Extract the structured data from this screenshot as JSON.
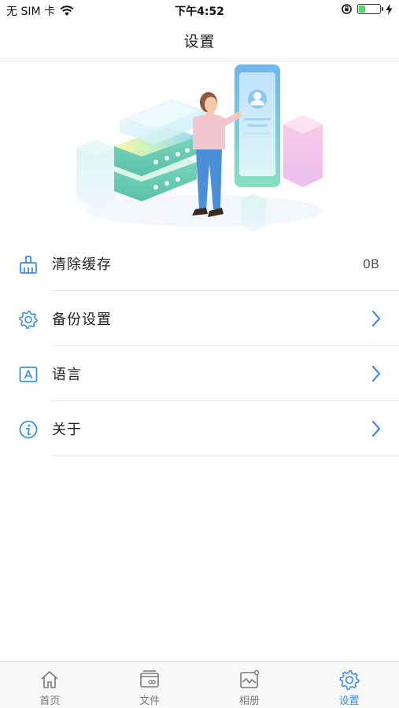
{
  "status_bar": {
    "carrier": "无 SIM 卡",
    "time": "下午4:52",
    "battery_level": 0.3
  },
  "nav": {
    "title": "设置"
  },
  "settings": {
    "items": [
      {
        "label": "清除缓存",
        "value": "0B",
        "icon": "broom-icon"
      },
      {
        "label": "备份设置",
        "icon": "gear-icon"
      },
      {
        "label": "语言",
        "icon": "language-icon"
      },
      {
        "label": "关于",
        "icon": "info-icon"
      }
    ]
  },
  "tab_bar": {
    "tabs": [
      {
        "label": "首页",
        "icon": "home-icon"
      },
      {
        "label": "文件",
        "icon": "file-icon"
      },
      {
        "label": "相册",
        "icon": "album-icon"
      },
      {
        "label": "设置",
        "icon": "settings-icon",
        "active": true
      }
    ]
  },
  "colors": {
    "accent": "#3b8fe8",
    "icon": "#3b8fe8",
    "tab_inactive": "#7a7a7a"
  }
}
